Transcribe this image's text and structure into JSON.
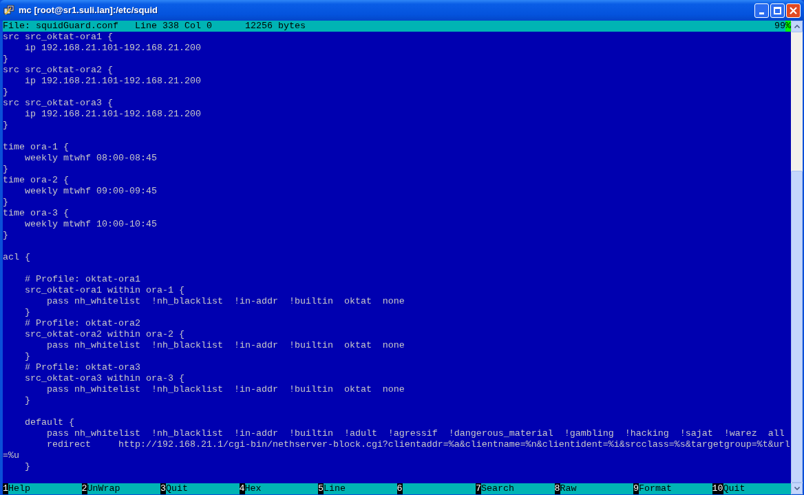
{
  "window": {
    "title": "mc [root@sr1.suli.lan]:/etc/squid"
  },
  "status_line": {
    "info": "File: squidGuard.conf   Line 338 Col 0      12256 bytes",
    "percent": "99%"
  },
  "blocks": [
    [
      "src src_oktat-ora1 {",
      "    ip 192.168.21.101-192.168.21.200",
      "}",
      "src src_oktat-ora2 {",
      "    ip 192.168.21.101-192.168.21.200",
      "}",
      "src src_oktat-ora3 {",
      "    ip 192.168.21.101-192.168.21.200",
      "}"
    ],
    [
      "time ora-1 {",
      "    weekly mtwhf 08:00-08:45",
      "}",
      "time ora-2 {",
      "    weekly mtwhf 09:00-09:45",
      "}",
      "time ora-3 {",
      "    weekly mtwhf 10:00-10:45",
      "}"
    ],
    [
      "acl {"
    ],
    [
      "    # Profile: oktat-ora1",
      "    src_oktat-ora1 within ora-1 {",
      "        pass nh_whitelist  !nh_blacklist  !in-addr  !builtin  oktat  none",
      "    }",
      "    # Profile: oktat-ora2",
      "    src_oktat-ora2 within ora-2 {",
      "        pass nh_whitelist  !nh_blacklist  !in-addr  !builtin  oktat  none",
      "    }",
      "    # Profile: oktat-ora3",
      "    src_oktat-ora3 within ora-3 {",
      "        pass nh_whitelist  !nh_blacklist  !in-addr  !builtin  oktat  none",
      "    }"
    ],
    [
      "    default {",
      "        pass nh_whitelist  !nh_blacklist  !in-addr  !builtin  !adult  !agressif  !dangerous_material  !gambling  !hacking  !sajat  !warez  all",
      "        redirect     http://192.168.21.1/cgi-bin/nethserver-block.cgi?clientaddr=%a&clientname=%n&clientident=%i&srcclass=%s&targetgroup=%t&url",
      "=%u",
      "    }"
    ]
  ],
  "function_keys": [
    {
      "number": "1",
      "label": "Help"
    },
    {
      "number": "2",
      "label": "UnWrap"
    },
    {
      "number": "3",
      "label": "Quit"
    },
    {
      "number": "4",
      "label": "Hex"
    },
    {
      "number": "5",
      "label": "Line"
    },
    {
      "number": "6"
    },
    {
      "number": "7",
      "label": "Search"
    },
    {
      "number": "8",
      "label": "Raw"
    },
    {
      "number": "9",
      "label": "Format"
    },
    {
      "number": "10",
      "label": "Quit"
    }
  ]
}
